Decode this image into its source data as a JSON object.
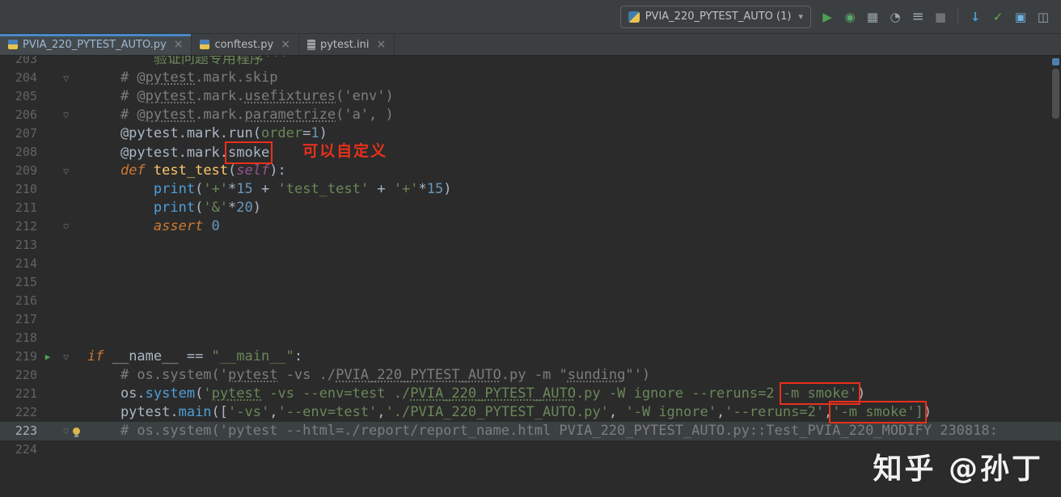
{
  "titlebar": {
    "run_config_label": "PVIA_220_PYTEST_AUTO (1)",
    "icons": [
      {
        "name": "run",
        "interactable": true
      },
      {
        "name": "debug",
        "interactable": true
      },
      {
        "name": "coverage",
        "interactable": true
      },
      {
        "name": "profiler",
        "interactable": true
      },
      {
        "name": "concurrency",
        "interactable": true
      },
      {
        "name": "stop",
        "interactable": false
      },
      {
        "name": "separator",
        "interactable": false
      },
      {
        "name": "update-project",
        "interactable": true
      },
      {
        "name": "commit",
        "interactable": true
      },
      {
        "name": "layout",
        "interactable": true
      },
      {
        "name": "restore",
        "interactable": true
      }
    ]
  },
  "tabs": [
    {
      "label": "PVIA_220_PYTEST_AUTO.py",
      "icon": "python",
      "active": true
    },
    {
      "label": "conftest.py",
      "icon": "python",
      "active": false
    },
    {
      "label": "pytest.ini",
      "icon": "ini",
      "active": false
    }
  ],
  "editor": {
    "lines": [
      {
        "n": 203,
        "seg": [
          [
            "        ",
            "d"
          ],
          [
            "验证问题专用程序'''",
            "s"
          ]
        ]
      },
      {
        "n": 204,
        "fold": "open",
        "seg": [
          [
            "    ",
            "d"
          ],
          [
            "# @",
            "c"
          ],
          [
            "pytest",
            "c u"
          ],
          [
            ".mark.skip",
            "c"
          ]
        ]
      },
      {
        "n": 205,
        "seg": [
          [
            "    ",
            "d"
          ],
          [
            "# @",
            "c"
          ],
          [
            "pytest",
            "c u"
          ],
          [
            ".mark.",
            "c"
          ],
          [
            "usefixtures",
            "c u"
          ],
          [
            "('env')",
            "c"
          ]
        ]
      },
      {
        "n": 206,
        "fold": "end",
        "seg": [
          [
            "    ",
            "d"
          ],
          [
            "# @",
            "c"
          ],
          [
            "pytest",
            "c u"
          ],
          [
            ".mark.",
            "c"
          ],
          [
            "parametrize",
            "c u"
          ],
          [
            "('a', )",
            "c"
          ]
        ]
      },
      {
        "n": 207,
        "seg": [
          [
            "    @pytest.mark.run(",
            "d"
          ],
          [
            "order",
            "a"
          ],
          [
            "=",
            "d"
          ],
          [
            "1",
            "n"
          ],
          [
            ")",
            "d"
          ]
        ]
      },
      {
        "n": 208,
        "seg": [
          [
            "    @pytest.mark.",
            "d"
          ],
          [
            "smoke",
            "d rb"
          ],
          [
            "    ",
            "d"
          ],
          [
            "可以自定义",
            "note"
          ]
        ]
      },
      {
        "n": 209,
        "fold": "open",
        "seg": [
          [
            "    ",
            "d"
          ],
          [
            "def ",
            "k"
          ],
          [
            "test_test",
            "f"
          ],
          [
            "(",
            "d"
          ],
          [
            "self",
            "p"
          ],
          [
            "):",
            "d"
          ]
        ]
      },
      {
        "n": 210,
        "seg": [
          [
            "        ",
            "d"
          ],
          [
            "print",
            "b"
          ],
          [
            "(",
            "d"
          ],
          [
            "'+'",
            "s"
          ],
          [
            "*",
            "d"
          ],
          [
            "15",
            "n"
          ],
          [
            " + ",
            "d"
          ],
          [
            "'test_test'",
            "s"
          ],
          [
            " + ",
            "d"
          ],
          [
            "'+'",
            "s"
          ],
          [
            "*",
            "d"
          ],
          [
            "15",
            "n"
          ],
          [
            ")",
            "d"
          ]
        ]
      },
      {
        "n": 211,
        "seg": [
          [
            "        ",
            "d"
          ],
          [
            "print",
            "b"
          ],
          [
            "(",
            "d"
          ],
          [
            "'&'",
            "s"
          ],
          [
            "*",
            "d"
          ],
          [
            "20",
            "n"
          ],
          [
            ")",
            "d"
          ]
        ]
      },
      {
        "n": 212,
        "fold": "end",
        "seg": [
          [
            "        ",
            "d"
          ],
          [
            "assert ",
            "k"
          ],
          [
            "0",
            "n"
          ]
        ]
      },
      {
        "n": 213,
        "seg": []
      },
      {
        "n": 214,
        "seg": []
      },
      {
        "n": 215,
        "seg": []
      },
      {
        "n": 216,
        "seg": []
      },
      {
        "n": 217,
        "seg": []
      },
      {
        "n": 218,
        "seg": []
      },
      {
        "n": 219,
        "run": true,
        "fold": "open",
        "seg": [
          [
            "if ",
            "k"
          ],
          [
            "__name__ == ",
            "d"
          ],
          [
            "\"__main__\"",
            "s"
          ],
          [
            ":",
            "d"
          ]
        ]
      },
      {
        "n": 220,
        "seg": [
          [
            "    ",
            "d"
          ],
          [
            "# os.system('",
            "c"
          ],
          [
            "pytest",
            "c u"
          ],
          [
            " -vs ./",
            "c"
          ],
          [
            "PVIA_220_PYTEST_AUTO",
            "c u"
          ],
          [
            ".py -m \"",
            "c"
          ],
          [
            "sunding",
            "c u"
          ],
          [
            "\"')",
            "c"
          ]
        ]
      },
      {
        "n": 221,
        "seg": [
          [
            "    os.",
            "d"
          ],
          [
            "system",
            "b"
          ],
          [
            "(",
            "d"
          ],
          [
            "'",
            "s"
          ],
          [
            "pytest",
            "s u"
          ],
          [
            " -vs --env=test ./",
            "s"
          ],
          [
            "PVIA_220_PYTEST_AUTO",
            "s u"
          ],
          [
            ".py -W ignore --reruns=2 ",
            "s"
          ],
          [
            "-m smoke'",
            "s rb"
          ],
          [
            ")",
            "d"
          ]
        ]
      },
      {
        "n": 222,
        "seg": [
          [
            "    pytest.",
            "d"
          ],
          [
            "main",
            "b"
          ],
          [
            "([",
            "d"
          ],
          [
            "'-vs'",
            "s"
          ],
          [
            ",",
            "d"
          ],
          [
            "'--env=test'",
            "s"
          ],
          [
            ",",
            "d"
          ],
          [
            "'./PVIA_220_PYTEST_AUTO.py'",
            "s"
          ],
          [
            ", ",
            "d"
          ],
          [
            "'-W ignore'",
            "s"
          ],
          [
            ",",
            "d"
          ],
          [
            "'--reruns=2'",
            "s"
          ],
          [
            ",",
            "d"
          ],
          [
            "'-m smoke']",
            "s rb"
          ],
          [
            ")",
            "d"
          ]
        ]
      },
      {
        "n": 223,
        "cur": true,
        "fold": "end",
        "bulb": true,
        "seg": [
          [
            "    ",
            "d"
          ],
          [
            "# os.system('pytest --html=./report/report_name.html PVIA_220_PYTEST_AUTO.py::Test_PVIA_220_MODIFY 230818:",
            "c"
          ]
        ]
      },
      {
        "n": 224,
        "seg": []
      }
    ]
  },
  "watermark": "知乎 @孙丁"
}
